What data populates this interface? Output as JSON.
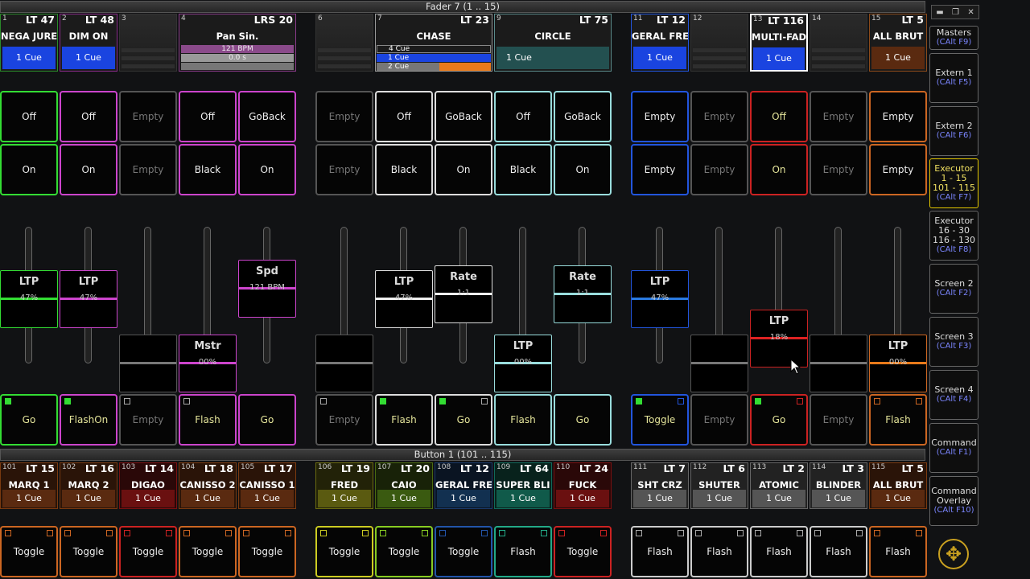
{
  "fader_header": "Fader  7 (1 .. 15)",
  "button_header": "Button  1 (101 .. 115)",
  "executors": [
    {
      "num": "1",
      "lt": "LT  47",
      "name": "NEGA JURE",
      "cue": "1 Cue"
    },
    {
      "num": "2",
      "lt": "LT  48",
      "name": "DIM ON",
      "cue": "1 Cue"
    },
    {
      "num": "3"
    },
    {
      "num": "4",
      "lt": "LRS      20",
      "name": "Pan Sin.",
      "bpm": "121 BPM",
      "time": "0.0 s"
    },
    {
      "num": "6"
    },
    {
      "num": "7",
      "lt": "LT      23",
      "name": "CHASE",
      "cues": [
        "4 Cue",
        "1 Cue",
        "2 Cue"
      ]
    },
    {
      "num": "9",
      "lt": "LT      75",
      "name": "CIRCLE",
      "cue": "1 Cue"
    },
    {
      "num": "11",
      "lt": "LT  12",
      "name": "GERAL FRE",
      "cue": "1 Cue"
    },
    {
      "num": "12"
    },
    {
      "num": "13",
      "lt": "LT 116",
      "name": "MULTI-FAD",
      "cue": "1 Cue"
    },
    {
      "num": "14"
    },
    {
      "num": "15",
      "lt": "LT   5",
      "name": "ALL BRUT",
      "cue": "1 Cue"
    }
  ],
  "row1": [
    "Off",
    "Off",
    "Empty",
    "Off",
    "GoBack",
    "Empty",
    "Off",
    "GoBack",
    "Off",
    "GoBack",
    "Empty",
    "Empty",
    "Off",
    "Empty",
    "Empty"
  ],
  "row2": [
    "On",
    "On",
    "Empty",
    "Black",
    "On",
    "Empty",
    "Black",
    "On",
    "Black",
    "On",
    "Empty",
    "Empty",
    "On",
    "Empty",
    "Empty"
  ],
  "faders": [
    {
      "title": "LTP",
      "value": "47%"
    },
    {
      "title": "LTP",
      "value": "47%"
    },
    {
      "title": "Mstr",
      "value": "00%"
    },
    {
      "title": "Spd",
      "value": "121 BPM"
    },
    {
      "title": "LTP",
      "value": "47%"
    },
    {
      "title": "Rate",
      "value": "1:1"
    },
    {
      "title": "LTP",
      "value": "00%"
    },
    {
      "title": "Rate",
      "value": "1:1"
    },
    {
      "title": "LTP",
      "value": "47%"
    },
    {
      "title": "LTP",
      "value": "18%"
    },
    {
      "title": "LTP",
      "value": "00%"
    }
  ],
  "row3": [
    "Go",
    "FlashOn",
    "Empty",
    "Flash",
    "Go",
    "Empty",
    "Flash",
    "Go",
    "Flash",
    "Go",
    "Toggle",
    "Empty",
    "Go",
    "Empty",
    "Flash"
  ],
  "buttons": [
    {
      "num": "101",
      "lt": "LT  15",
      "name": "MARQ 1",
      "cue": "1 Cue"
    },
    {
      "num": "102",
      "lt": "LT  16",
      "name": "MARQ 2",
      "cue": "1 Cue"
    },
    {
      "num": "103",
      "lt": "LT  14",
      "name": "DIGAO",
      "cue": "1 Cue"
    },
    {
      "num": "104",
      "lt": "LT  18",
      "name": "CANISSO 2",
      "cue": "1 Cue"
    },
    {
      "num": "105",
      "lt": "LT  17",
      "name": "CANISSO 1",
      "cue": "1 Cue"
    },
    {
      "num": "106",
      "lt": "LT  19",
      "name": "FRED",
      "cue": "1 Cue"
    },
    {
      "num": "107",
      "lt": "LT  20",
      "name": "CAIO",
      "cue": "1 Cue"
    },
    {
      "num": "108",
      "lt": "LT  12",
      "name": "GERAL FRE",
      "cue": "1 Cue"
    },
    {
      "num": "109",
      "lt": "LT  64",
      "name": "SUPER BLI",
      "cue": "1 Cue"
    },
    {
      "num": "110",
      "lt": "LT  24",
      "name": "FUCK",
      "cue": "1 Cue"
    },
    {
      "num": "111",
      "lt": "LT   7",
      "name": "SHT CRZ",
      "cue": "1 Cue"
    },
    {
      "num": "112",
      "lt": "LT   6",
      "name": "SHUTER",
      "cue": "1 Cue"
    },
    {
      "num": "113",
      "lt": "LT   2",
      "name": "ATOMIC",
      "cue": "1 Cue"
    },
    {
      "num": "114",
      "lt": "LT   3",
      "name": "BLINDER",
      "cue": "1 Cue"
    },
    {
      "num": "115",
      "lt": "LT   5",
      "name": "ALL BRUT",
      "cue": "1 Cue"
    }
  ],
  "row4": [
    "Toggle",
    "Toggle",
    "Toggle",
    "Toggle",
    "Toggle",
    "Toggle",
    "Toggle",
    "Toggle",
    "Flash",
    "Toggle",
    "Flash",
    "Flash",
    "Flash",
    "Flash",
    "Flash"
  ],
  "sidebar": [
    {
      "label": "Masters",
      "key": "(CAlt F9)"
    },
    {
      "label": "Extern 1",
      "key": "(CAlt F5)"
    },
    {
      "label": "Extern 2",
      "key": "(CAlt F6)"
    },
    {
      "label": "Executor\n1 - 15\n101 - 115",
      "key": "(CAlt F7)"
    },
    {
      "label": "Executor\n16 - 30\n116 - 130",
      "key": "(CAlt F8)"
    },
    {
      "label": "Screen 2",
      "key": "(CAlt F2)"
    },
    {
      "label": "Screen 3",
      "key": "(CAlt F3)"
    },
    {
      "label": "Screen 4",
      "key": "(CAlt F4)"
    },
    {
      "label": "Command",
      "key": "(CAlt F1)"
    },
    {
      "label": "Command\nOverlay",
      "key": "(CAlt F10)"
    }
  ],
  "colors": {
    "green": "#33dd33",
    "magenta": "#cc44cc",
    "gray": "#555555",
    "white": "#dddddd",
    "teal": "#99dddd",
    "blue": "#2255dd",
    "red": "#cc2222",
    "orange": "#cc6622"
  }
}
